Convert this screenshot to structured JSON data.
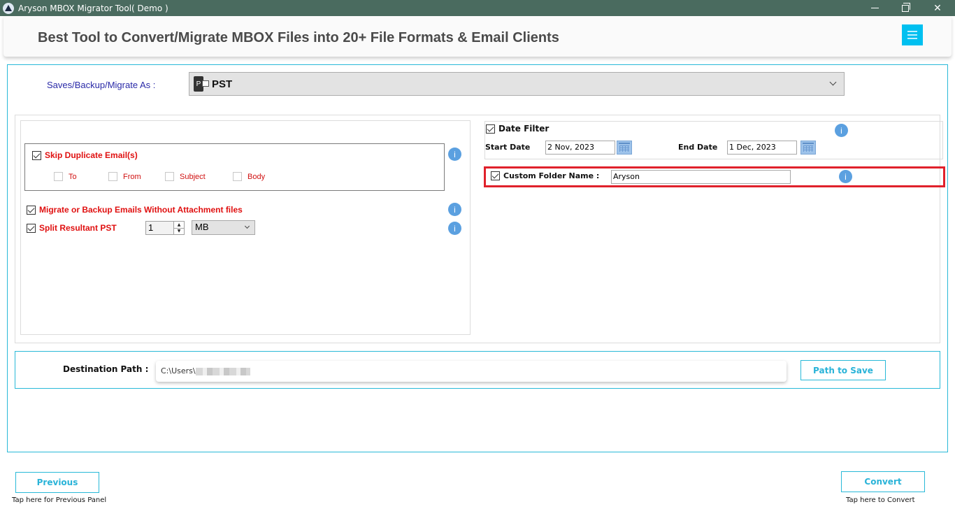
{
  "window": {
    "title": "Aryson MBOX Migrator Tool( Demo )",
    "icon": "aryson-logo-icon",
    "controls": [
      "minimize",
      "restore",
      "close"
    ]
  },
  "banner": {
    "headline": "Best Tool to Convert/Migrate MBOX Files into 20+ File Formats & Email Clients",
    "menu_icon": "hamburger-menu-icon",
    "accent_color": "#00c0f0"
  },
  "save_as": {
    "label": "Saves/Backup/Migrate As :",
    "selected": "PST",
    "icon": "outlook-pst-icon",
    "icon_letter": "P"
  },
  "options": {
    "skip_duplicate": {
      "label": "Skip Duplicate Email(s)",
      "checked": true,
      "sub_options": [
        {
          "label": "To",
          "checked": false
        },
        {
          "label": "From",
          "checked": false
        },
        {
          "label": "Subject",
          "checked": false
        },
        {
          "label": "Body",
          "checked": false
        }
      ]
    },
    "without_attachment": {
      "label": "Migrate or Backup Emails Without Attachment files",
      "checked": true
    },
    "split_pst": {
      "label": "Split Resultant PST",
      "checked": true,
      "size_value": "1",
      "unit": "MB"
    },
    "date_filter": {
      "label": "Date Filter",
      "checked": true,
      "start_label": "Start Date",
      "start_value": "2 Nov, 2023",
      "end_label": "End Date",
      "end_value": "1 Dec, 2023"
    },
    "custom_folder": {
      "label": "Custom Folder Name :",
      "checked": true,
      "value": "Aryson",
      "highlight_color": "#e0212b"
    },
    "info_glyph": "i"
  },
  "destination": {
    "label": "Destination Path :",
    "value": "C:\\Users\\",
    "button": "Path to Save"
  },
  "footer": {
    "previous_label": "Previous",
    "previous_hint": "Tap here for Previous Panel",
    "convert_label": "Convert",
    "convert_hint": "Tap here to Convert"
  },
  "colors": {
    "titlebar": "#4a6b5f",
    "accent": "#29b9d8",
    "option_red": "#e01010",
    "label_blue": "#2a2aa8",
    "info_blue": "#5ba0e0"
  }
}
